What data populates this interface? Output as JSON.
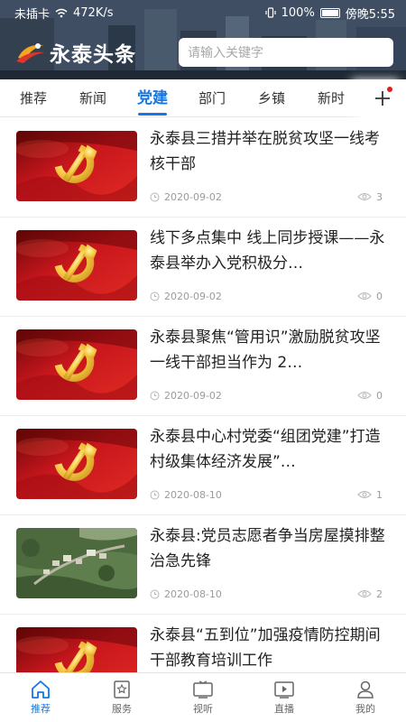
{
  "status_bar": {
    "left_text": "未插卡",
    "network_speed": "472K/s",
    "battery": "100%",
    "time": "傍晚5:55"
  },
  "header": {
    "logo_text": "永泰头条",
    "search_placeholder": "请输入关键字"
  },
  "tabs": [
    {
      "label": "推荐",
      "active": false
    },
    {
      "label": "新闻",
      "active": false
    },
    {
      "label": "党建",
      "active": true
    },
    {
      "label": "部门",
      "active": false
    },
    {
      "label": "乡镇",
      "active": false
    },
    {
      "label": "新时",
      "active": false
    }
  ],
  "articles": [
    {
      "title": "永泰县三措并举在脱贫攻坚一线考核干部",
      "date": "2020-09-02",
      "views": "3",
      "image": "party-flag"
    },
    {
      "title": "线下多点集中 线上同步授课——永泰县举办入党积极分…",
      "date": "2020-09-02",
      "views": "0",
      "image": "party-flag"
    },
    {
      "title": "永泰县聚焦“管用识”激励脱贫攻坚一线干部担当作为 2…",
      "date": "2020-09-02",
      "views": "0",
      "image": "party-flag"
    },
    {
      "title": "永泰县中心村党委“组团党建”打造村级集体经济发展”…",
      "date": "2020-08-10",
      "views": "1",
      "image": "party-flag"
    },
    {
      "title": "永泰县:党员志愿者争当房屋摸排整治急先锋",
      "date": "2020-08-10",
      "views": "2",
      "image": "aerial-village"
    },
    {
      "title": "永泰县“五到位”加强疫情防控期间干部教育培训工作",
      "date": "",
      "views": "",
      "image": "party-flag"
    }
  ],
  "bottom_nav": [
    {
      "label": "推荐",
      "icon": "home-icon",
      "active": true
    },
    {
      "label": "服务",
      "icon": "star-doc-icon",
      "active": false
    },
    {
      "label": "视听",
      "icon": "tv-icon",
      "active": false
    },
    {
      "label": "直播",
      "icon": "play-screen-icon",
      "active": false
    },
    {
      "label": "我的",
      "icon": "user-icon",
      "active": false
    }
  ],
  "colors": {
    "accent": "#1677e5",
    "party_red": "#c8161d",
    "gold": "#f6c945",
    "badge_red": "#e02020"
  }
}
